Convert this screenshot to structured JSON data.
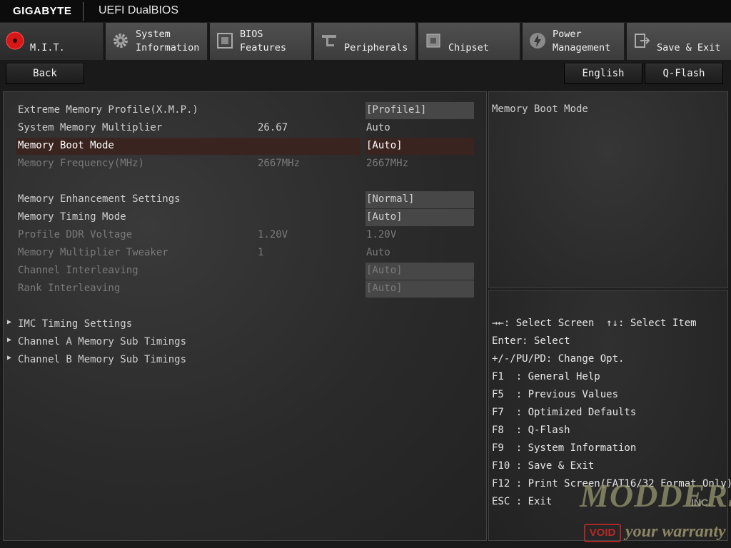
{
  "header": {
    "brand": "GIGABYTE",
    "title": "UEFI DualBIOS"
  },
  "tabs": [
    {
      "label": "M.I.T.",
      "icon": "mit-icon"
    },
    {
      "label": "System\nInformation",
      "icon": "gear-icon"
    },
    {
      "label": "BIOS\nFeatures",
      "icon": "bios-icon"
    },
    {
      "label": "Peripherals",
      "icon": "peripherals-icon"
    },
    {
      "label": "Chipset",
      "icon": "chipset-icon"
    },
    {
      "label": "Power\nManagement",
      "icon": "power-icon"
    },
    {
      "label": "Save & Exit",
      "icon": "exit-icon"
    }
  ],
  "toolbar": {
    "back": "Back",
    "language": "English",
    "qflash": "Q-Flash"
  },
  "settings": [
    {
      "label": "Extreme Memory Profile(X.M.P.)",
      "mid": "",
      "value": "[Profile1]"
    },
    {
      "label": "System Memory Multiplier",
      "mid": "26.67",
      "value": "Auto"
    },
    {
      "label": "Memory Boot Mode",
      "mid": "",
      "value": "[Auto]"
    },
    {
      "label": "Memory Frequency(MHz)",
      "mid": "2667MHz",
      "value": "2667MHz"
    },
    {
      "label": "Memory Enhancement Settings",
      "mid": "",
      "value": "[Normal]"
    },
    {
      "label": "Memory Timing Mode",
      "mid": "",
      "value": "[Auto]"
    },
    {
      "label": "Profile DDR Voltage",
      "mid": "1.20V",
      "value": "1.20V"
    },
    {
      "label": "Memory Multiplier Tweaker",
      "mid": "1",
      "value": "Auto"
    },
    {
      "label": "Channel Interleaving",
      "mid": "",
      "value": "[Auto]"
    },
    {
      "label": "Rank Interleaving",
      "mid": "",
      "value": "[Auto]"
    }
  ],
  "submenus": [
    {
      "label": "IMC Timing Settings"
    },
    {
      "label": "Channel A Memory Sub Timings"
    },
    {
      "label": "Channel B Memory Sub Timings"
    }
  ],
  "help": {
    "text": "Memory Boot Mode"
  },
  "keys": [
    "→←: Select Screen  ↑↓: Select Item",
    "Enter: Select",
    "+/-/PU/PD: Change Opt.",
    "F1  : General Help",
    "F5  : Previous Values",
    "F7  : Optimized Defaults",
    "F8  : Q-Flash",
    "F9  : System Information",
    "F10 : Save & Exit",
    "F12 : Print Screen(FAT16/32 Format Only)",
    "ESC : Exit"
  ],
  "watermark": {
    "site": "MODDERS",
    "inc": "INC.",
    "void": "VOID",
    "tagline": "your warranty"
  },
  "colors": {
    "selected_row": "#3a2420",
    "active_tab_icon": "#e02020",
    "value_box": "#474747"
  }
}
